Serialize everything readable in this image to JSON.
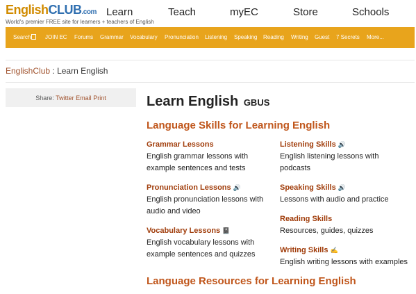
{
  "header": {
    "logo": {
      "english": "English",
      "club": "CLUB",
      "com": ".com"
    },
    "tagline": "World's premier FREE site for learners + teachers of English",
    "nav": [
      "Learn",
      "Teach",
      "myEC",
      "Store",
      "Schools"
    ]
  },
  "subnav": {
    "search_label": "Search",
    "items": [
      "JOIN EC",
      "Forums",
      "Grammar",
      "Vocabulary",
      "Pronunciation",
      "Listening",
      "Speaking",
      "Reading",
      "Writing",
      "Guest",
      "7 Secrets",
      "More..."
    ]
  },
  "breadcrumb": {
    "home": "EnglishClub",
    "separator": " : ",
    "current": "Learn English"
  },
  "share": {
    "label": "Share:",
    "links": [
      "Twitter",
      "Email",
      "Print"
    ]
  },
  "main": {
    "title": "Learn English",
    "title_code": "GBUS",
    "section1": "Language Skills for Learning English",
    "section2": "Language Resources for Learning English",
    "skills": [
      {
        "name": "Grammar Lessons",
        "desc1": "English grammar lessons with",
        "desc2": "example sentences and tests",
        "icon": ""
      },
      {
        "name": "Listening Skills",
        "desc1": "English listening lessons with",
        "desc2": "podcasts",
        "icon": "speaker-icon"
      },
      {
        "name": "Pronunciation Lessons",
        "desc1": "English pronunciation lessons with",
        "desc2": "audio and video",
        "icon": "speaker-icon"
      },
      {
        "name": "Speaking Skills",
        "desc1": "Lessons with audio and practice",
        "desc2": "",
        "icon": "speaker-icon"
      },
      {
        "name": "Vocabulary Lessons",
        "desc1": "English vocabulary lessons with",
        "desc2": "example sentences and quizzes",
        "icon": "book-icon"
      },
      {
        "name": "Reading Skills",
        "desc1": "Resources, guides, quizzes",
        "desc2": "",
        "icon": ""
      },
      {
        "name": "Writing Skills",
        "desc1": "English writing lessons with examples",
        "desc2": "",
        "icon": "pencil-icon"
      }
    ]
  },
  "colors": {
    "accent_orange": "#e8a41c",
    "heading_orange": "#c0561b",
    "link_brown": "#a03c0a"
  }
}
